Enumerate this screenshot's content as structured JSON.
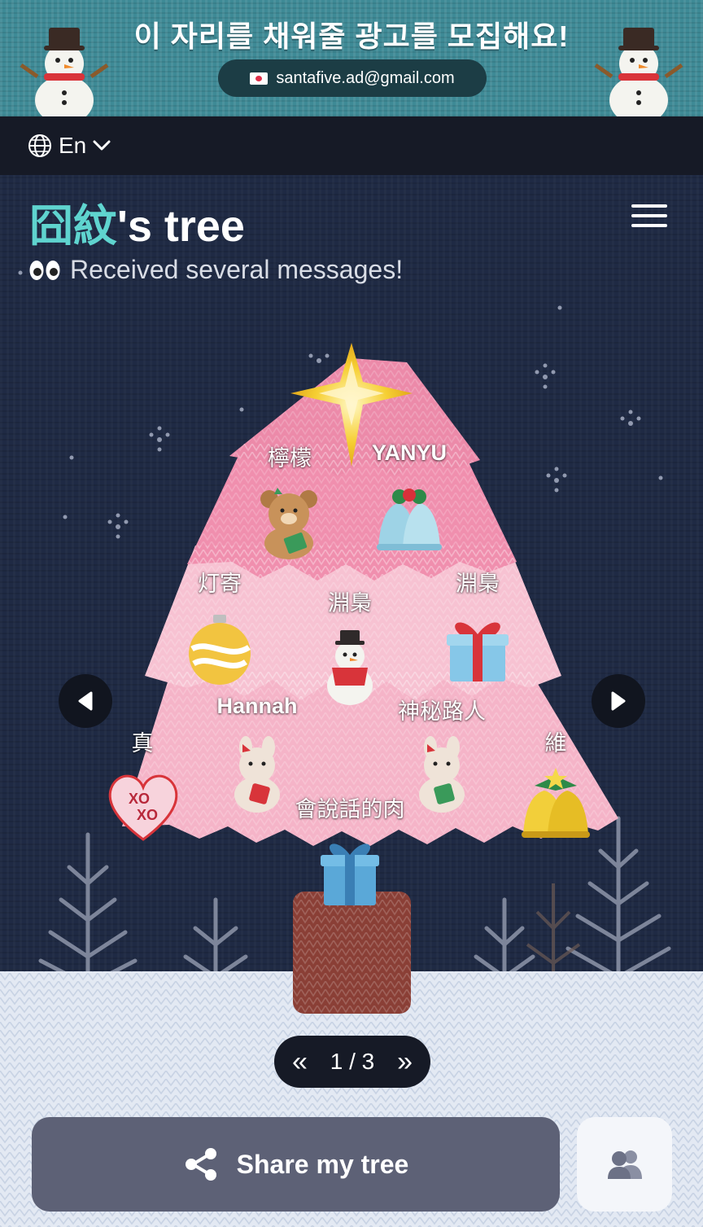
{
  "ad": {
    "headline": "이 자리를 채워줄 광고를 모집해요!",
    "email": "santafive.ad@gmail.com"
  },
  "topbar": {
    "language": "En"
  },
  "header": {
    "owner_name": "囧紋",
    "title_suffix": "'s tree",
    "subtitle": "Received several messages!"
  },
  "messages": [
    {
      "author": "檸檬",
      "ornament": "teddy-bear-icon"
    },
    {
      "author": "YANYU",
      "ornament": "blue-bells-icon"
    },
    {
      "author": "灯寄",
      "ornament": "yellow-bauble-icon"
    },
    {
      "author": "淵梟",
      "ornament": "snowman-icon"
    },
    {
      "author": "淵梟",
      "ornament": "gift-box-icon"
    },
    {
      "author": "Hannah",
      "ornament": "bunny-bear-icon"
    },
    {
      "author": "神秘路人",
      "ornament": "bunny-bear-icon"
    },
    {
      "author": "真",
      "ornament": "xoxo-heart-icon"
    },
    {
      "author": "會說話的肉",
      "ornament": "blue-gift-icon"
    },
    {
      "author": "維",
      "ornament": "golden-bells-icon"
    }
  ],
  "pagination": {
    "current": "1",
    "separator": "/",
    "total": "3"
  },
  "actions": {
    "share_label": "Share my tree"
  },
  "colors": {
    "accent": "#5fd4cf",
    "tree_pink": "#f4a3bd",
    "background": "#1f2a44",
    "share_button": "#5d6176"
  }
}
